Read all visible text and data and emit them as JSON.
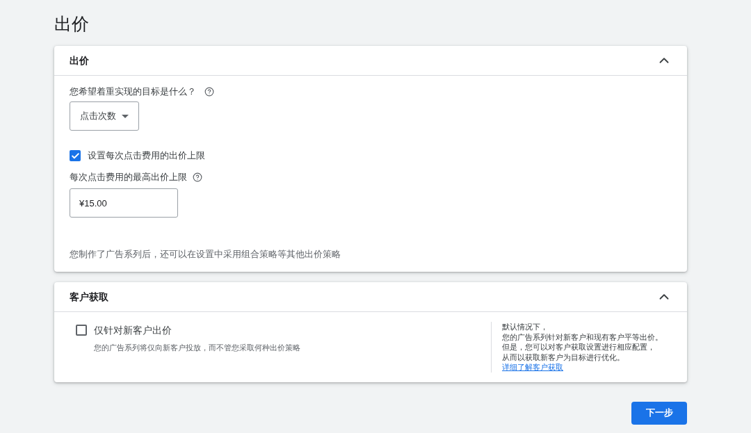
{
  "page": {
    "title": "出价"
  },
  "bidding": {
    "title": "出价",
    "expanded": true,
    "goal": {
      "label": "您希望着重实现的目标是什么？",
      "value": "点击次数"
    },
    "max_cpc": {
      "label": "设置每次点击费用的出价上限",
      "checked": true
    },
    "limit": {
      "label": "每次点击费用的最高出价上限",
      "value": "¥15.00"
    },
    "note": "您制作了广告系列后，还可以在设置中采用组合策略等其他出价策略"
  },
  "acquisition": {
    "title": "客户获取",
    "expanded": true,
    "option": {
      "label": "仅针对新客户出价",
      "checked": false,
      "description": "您的广告系列将仅向新客户投放，而不管您采取何种出价策略"
    },
    "info": {
      "lines": [
        "默认情况下，",
        "您的广告系列针对新客户和现有客户平等出价。",
        "但是，您可以对客户获取设置进行相应配置，",
        "从而以获取新客户为目标进行优化。"
      ],
      "link": "详细了解客户获取"
    }
  },
  "next_button": {
    "label": "下一步"
  }
}
